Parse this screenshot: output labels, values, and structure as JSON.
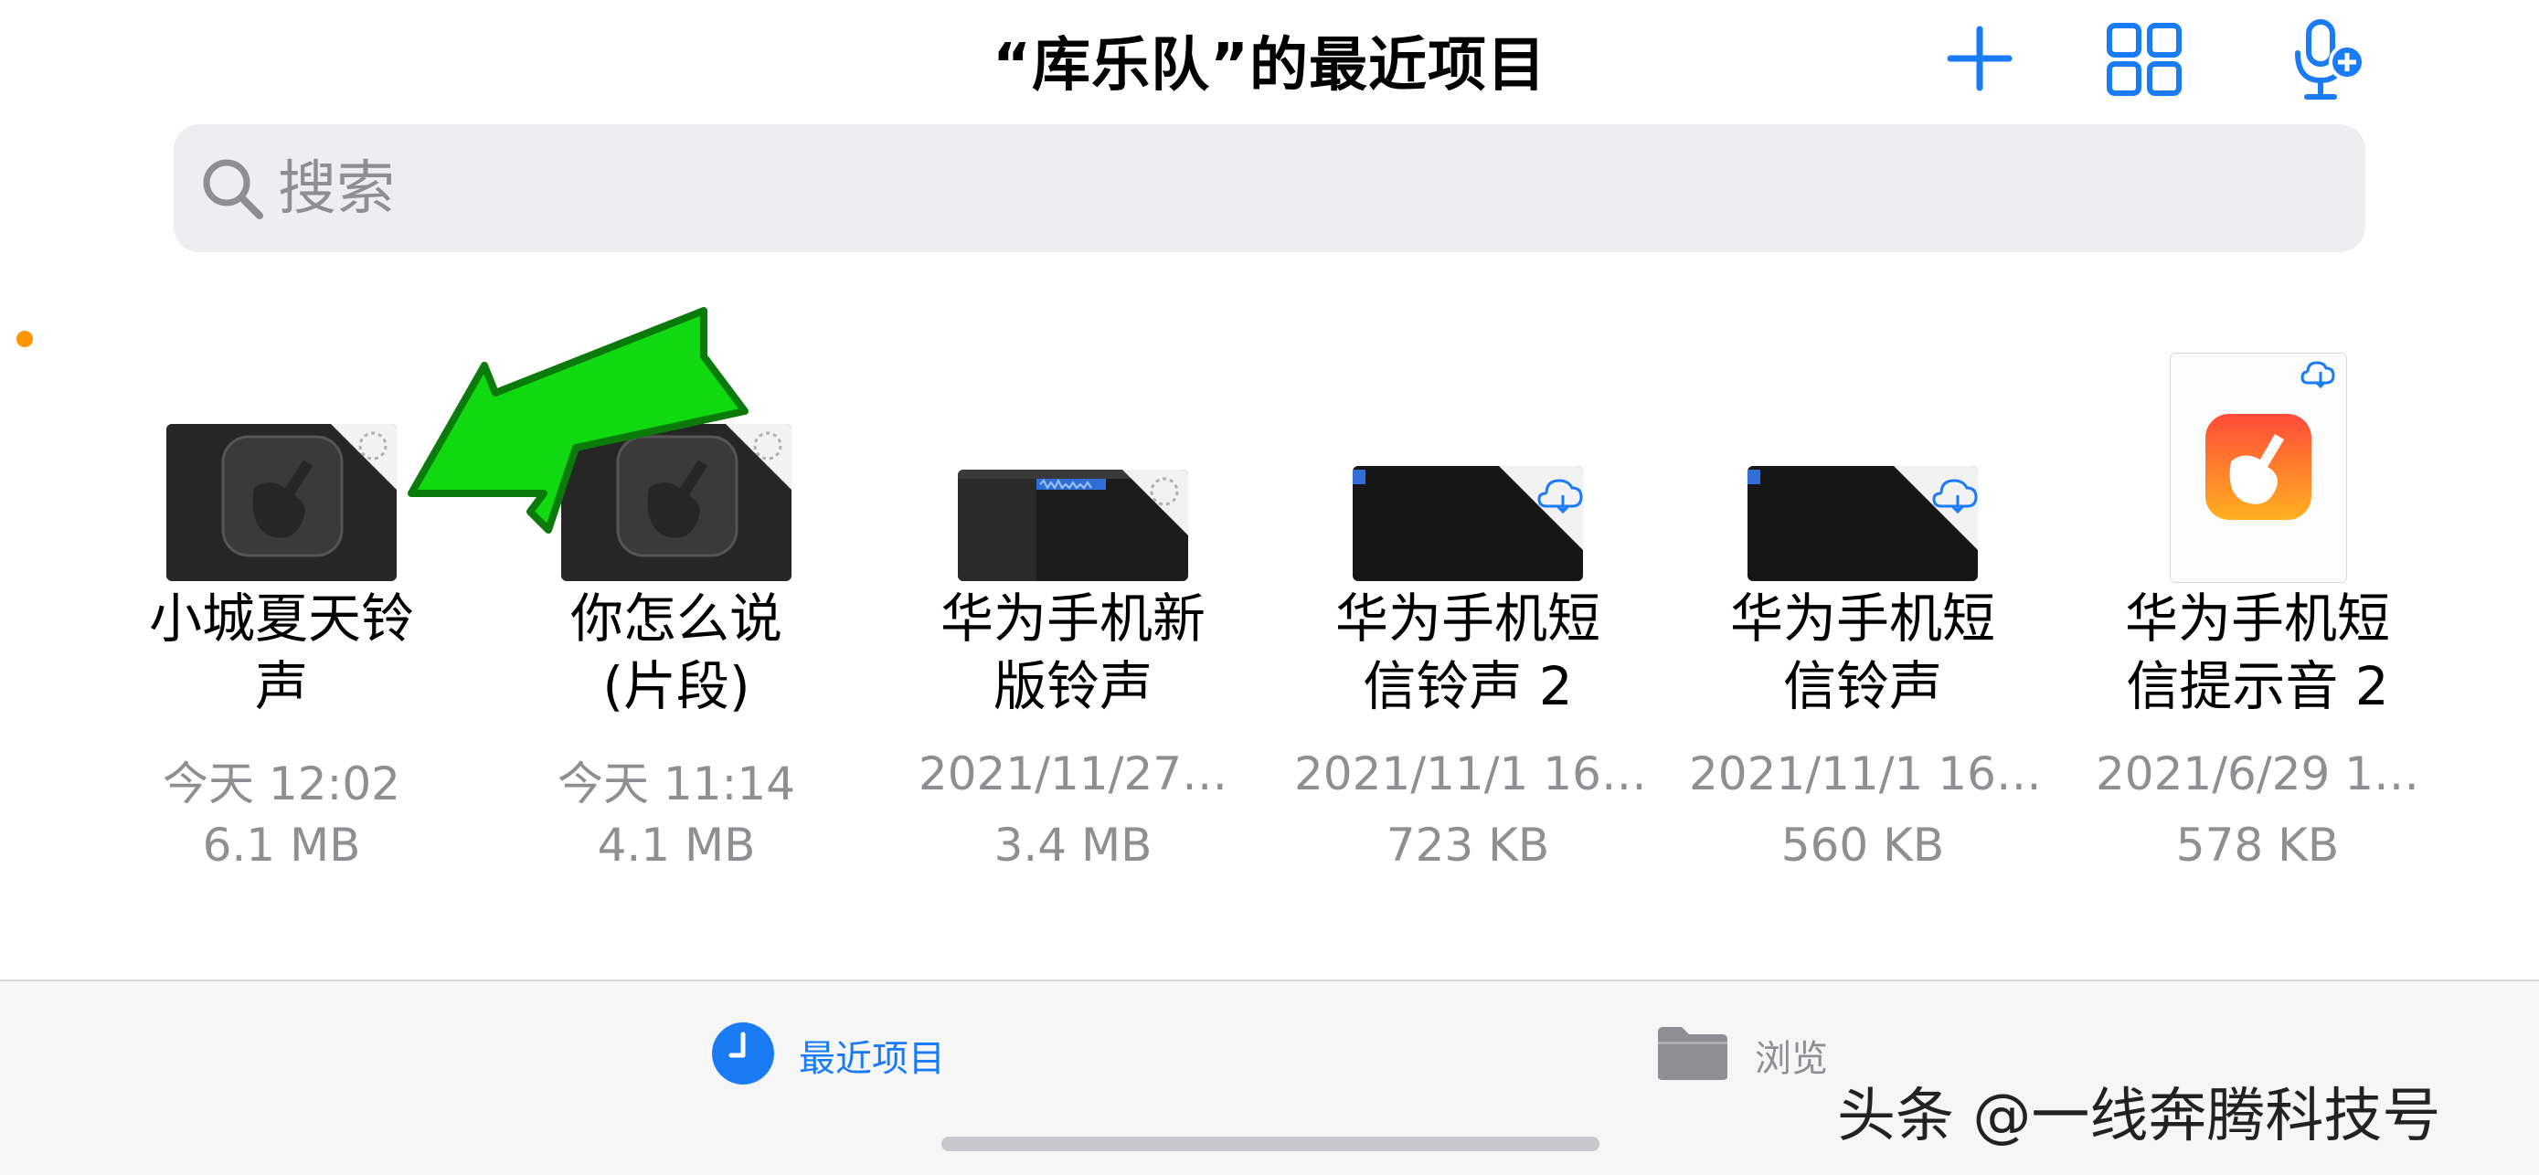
{
  "header": {
    "title": "“库乐队”的最近项目",
    "add_icon": "plus-icon",
    "grid_icon": "grid-view-icon",
    "mic_icon": "microphone-add-icon",
    "accent_color": "#1a7cf5"
  },
  "search": {
    "placeholder": "搜索",
    "value": "",
    "icon": "search-icon"
  },
  "files": [
    {
      "name_line1": "小城夏天铃",
      "name_line2": "声",
      "date": "今天 12:02",
      "size": "6.1 MB",
      "thumb": "garageband-project",
      "cloud": "pending"
    },
    {
      "name_line1": "你怎么说",
      "name_line2": "(片段)",
      "date": "今天 11:14",
      "size": "4.1 MB",
      "thumb": "garageband-project",
      "cloud": "pending"
    },
    {
      "name_line1": "华为手机新",
      "name_line2": "版铃声",
      "date": "2021/11/27…",
      "size": "3.4 MB",
      "thumb": "tracks-preview",
      "cloud": "pending"
    },
    {
      "name_line1": "华为手机短",
      "name_line2": "信铃声 2",
      "date": "2021/11/1 16…",
      "size": "723 KB",
      "thumb": "tracks-preview-dark",
      "cloud": "download"
    },
    {
      "name_line1": "华为手机短",
      "name_line2": "信铃声",
      "date": "2021/11/1 16…",
      "size": "560 KB",
      "thumb": "tracks-preview-dark",
      "cloud": "download"
    },
    {
      "name_line1": "华为手机短",
      "name_line2": "信提示音 2",
      "date": "2021/6/29 1…",
      "size": "578 KB",
      "thumb": "garageband-app-icon",
      "cloud": "download"
    }
  ],
  "tabbar": {
    "recent_label": "最近项目",
    "browse_label": "浏览",
    "active_color": "#1a7cf5",
    "inactive_color": "#8e8e93"
  },
  "watermark": "头条 @一线奔腾科技号"
}
